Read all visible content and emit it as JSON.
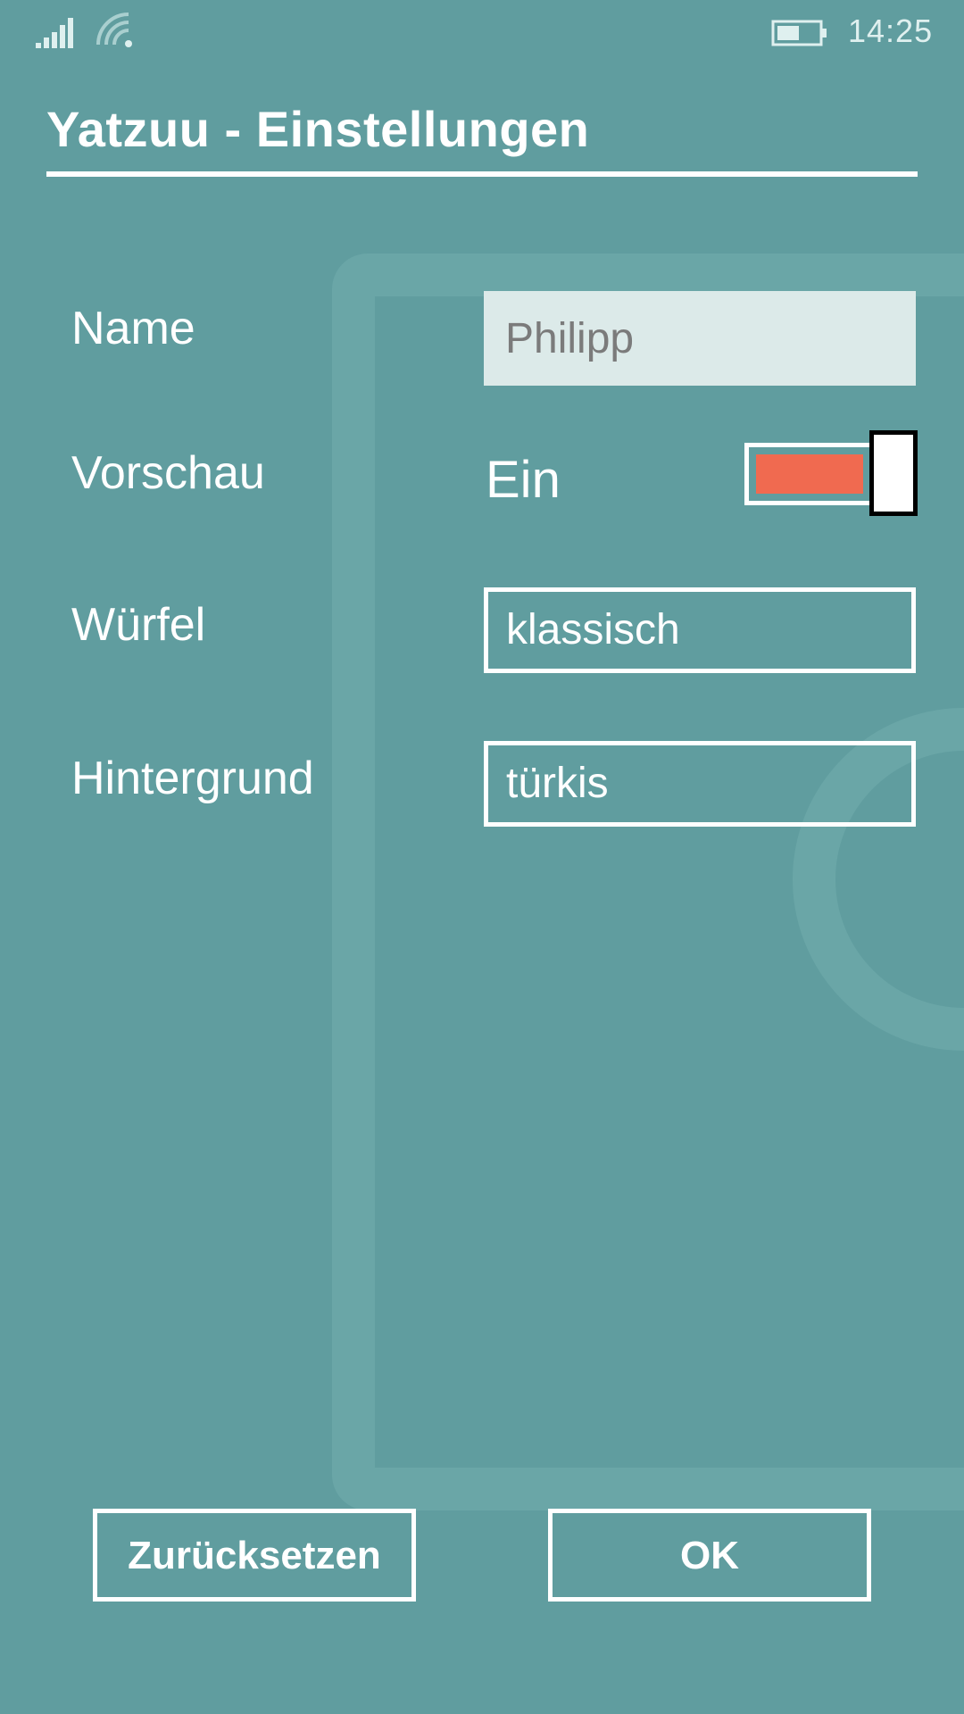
{
  "status_bar": {
    "time": "14:25",
    "icons": [
      "signal-icon",
      "wifi-icon",
      "battery-icon"
    ]
  },
  "header": {
    "title": "Yatzuu - Einstellungen"
  },
  "settings": {
    "name": {
      "label": "Name",
      "value": "Philipp"
    },
    "preview": {
      "label": "Vorschau",
      "state_text": "Ein",
      "on": true
    },
    "dice": {
      "label": "Würfel",
      "value": "klassisch"
    },
    "background": {
      "label": "Hintergrund",
      "value": "türkis"
    }
  },
  "buttons": {
    "reset": "Zurücksetzen",
    "ok": "OK"
  },
  "colors": {
    "background": "#609d9f",
    "accent": "#f06a50",
    "input_fill": "#dceae9"
  }
}
